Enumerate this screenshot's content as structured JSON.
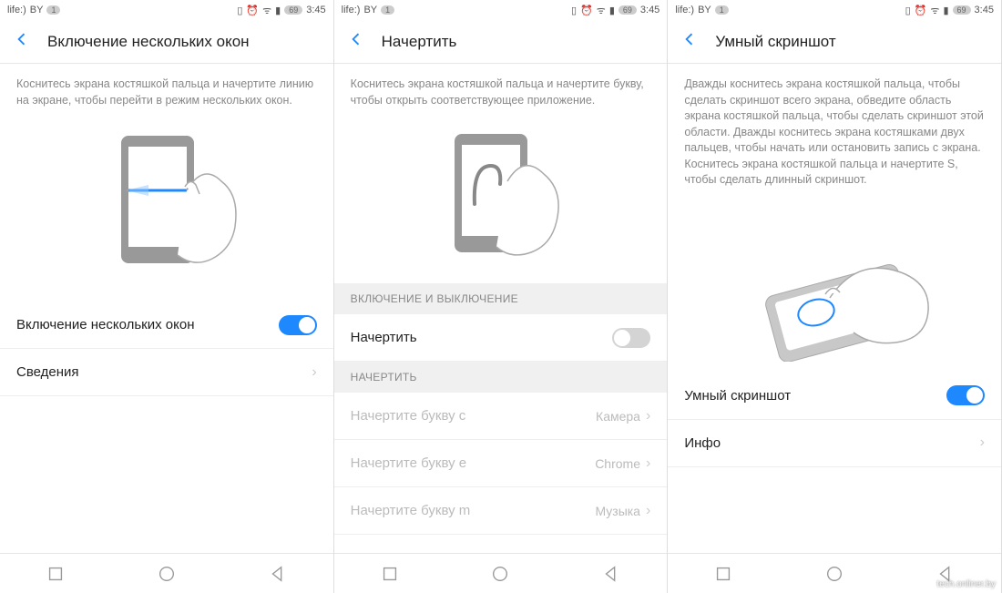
{
  "statusbar": {
    "carrier": "life:)",
    "region": "BY",
    "notif": "1",
    "battery": "69",
    "time": "3:45"
  },
  "screens": [
    {
      "title": "Включение нескольких окон",
      "desc": "Коснитесь экрана костяшкой пальца и начертите линию на экране, чтобы перейти в режим нескольких окон.",
      "rows": [
        {
          "label": "Включение нескольких окон",
          "type": "toggle",
          "on": true
        },
        {
          "label": "Сведения",
          "type": "link"
        }
      ]
    },
    {
      "title": "Начертить",
      "desc": "Коснитесь экрана костяшкой пальца и начертите букву, чтобы открыть соответствующее приложение.",
      "sections": [
        {
          "header": "ВКЛЮЧЕНИЕ И ВЫКЛЮЧЕНИЕ",
          "rows": [
            {
              "label": "Начертить",
              "type": "toggle",
              "on": false
            }
          ]
        },
        {
          "header": "НАЧЕРТИТЬ",
          "rows": [
            {
              "label": "Начертите букву c",
              "value": "Камера",
              "disabled": true
            },
            {
              "label": "Начертите букву e",
              "value": "Chrome",
              "disabled": true
            },
            {
              "label": "Начертите букву m",
              "value": "Музыка",
              "disabled": true
            }
          ]
        }
      ]
    },
    {
      "title": "Умный скриншот",
      "desc": "Дважды коснитесь экрана костяшкой пальца, чтобы сделать скриншот всего экрана, обведите область экрана костяшкой пальца, чтобы сделать скриншот этой области. Дважды коснитесь экрана костяшками двух пальцев, чтобы начать или остановить запись с экрана. Коснитесь экрана костяшкой пальца и начертите S, чтобы сделать длинный скриншот.",
      "rows": [
        {
          "label": "Умный скриншот",
          "type": "toggle",
          "on": true
        },
        {
          "label": "Инфо",
          "type": "link"
        }
      ]
    }
  ],
  "watermark": "tech.onliner.by"
}
